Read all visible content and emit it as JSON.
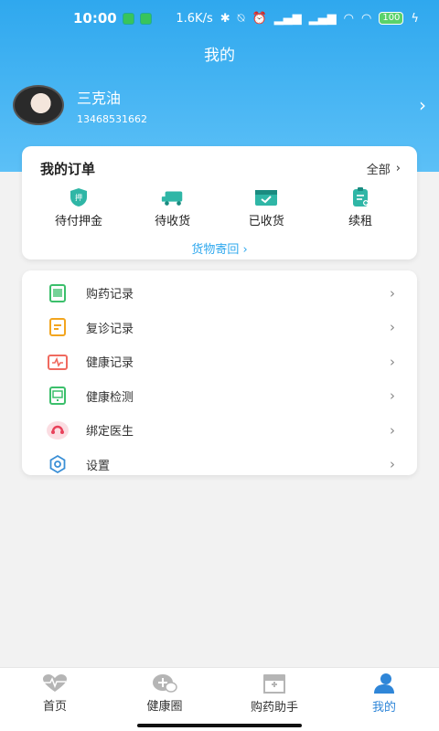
{
  "status_bar": {
    "time": "10:00",
    "speed": "1.6K/s",
    "battery": "100"
  },
  "page_title": "我的",
  "profile": {
    "name": "三克油",
    "phone": "13468531662"
  },
  "orders": {
    "title": "我的订单",
    "all_label": "全部",
    "items": [
      {
        "label": "待付押金",
        "icon": "deposit-shield-icon"
      },
      {
        "label": "待收货",
        "icon": "truck-icon"
      },
      {
        "label": "已收货",
        "icon": "box-check-icon"
      },
      {
        "label": "续租",
        "icon": "clipboard-plus-icon"
      }
    ],
    "footer_link": "货物寄回"
  },
  "menu": [
    {
      "label": "购药记录",
      "icon": "medicine-record-icon",
      "color": "#3bbf6b"
    },
    {
      "label": "复诊记录",
      "icon": "revisit-record-icon",
      "color": "#f2a51f"
    },
    {
      "label": "健康记录",
      "icon": "health-record-icon",
      "color": "#f06a5f"
    },
    {
      "label": "健康检测",
      "icon": "health-check-icon",
      "color": "#3bbf6b"
    },
    {
      "label": "绑定医生",
      "icon": "bind-doctor-icon",
      "color": "#e8415a"
    },
    {
      "label": "设置",
      "icon": "gear-icon",
      "color": "#3a8fd6"
    }
  ],
  "tabbar": [
    {
      "label": "首页",
      "icon": "heart-pulse-icon"
    },
    {
      "label": "健康圈",
      "icon": "chat-plus-icon"
    },
    {
      "label": "购药助手",
      "icon": "pharmacy-icon"
    },
    {
      "label": "我的",
      "icon": "user-icon",
      "active": true
    }
  ],
  "colors": {
    "accent": "#2fa8ee",
    "active_tab": "#2f86d8"
  }
}
